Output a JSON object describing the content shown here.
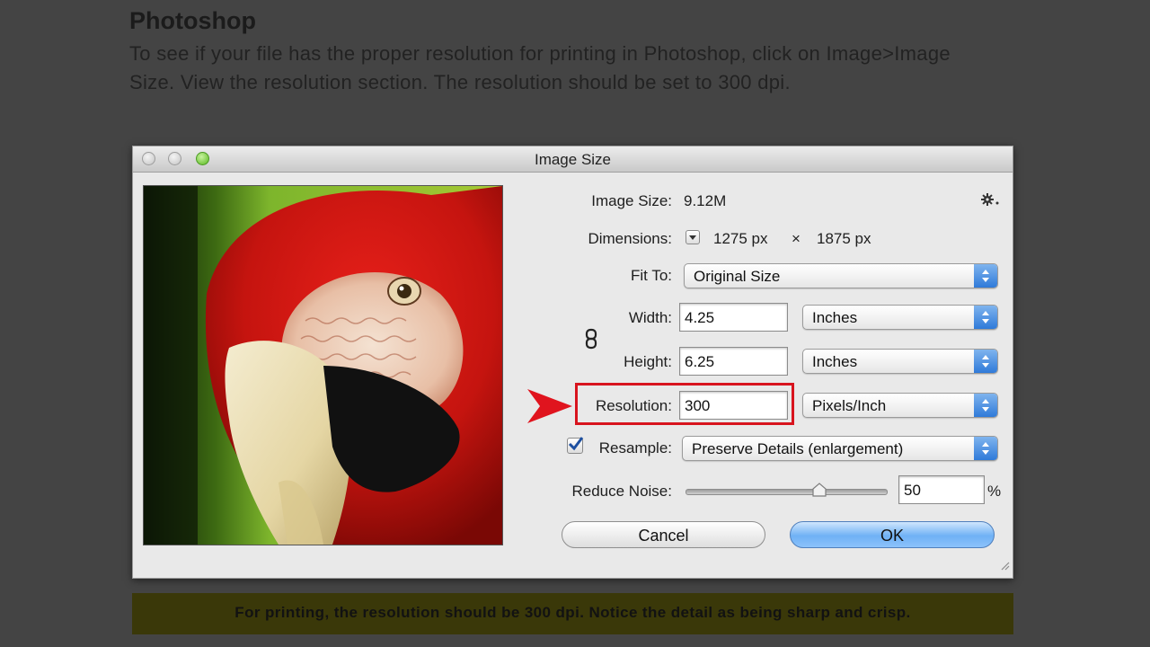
{
  "slide": {
    "title": "Photoshop",
    "description": "To see if your file has the proper resolution for printing in Photoshop, click on Image>Image Size. View the resolution section. The resolution should be set to 300 dpi.",
    "caption": "For printing, the resolution should be 300 dpi. Notice the detail as being sharp and crisp."
  },
  "dialog": {
    "title": "Image Size",
    "image_size_label": "Image Size:",
    "image_size_value": "9.12M",
    "dimensions_label": "Dimensions:",
    "dimensions_width": "1275 px",
    "dimensions_times": "×",
    "dimensions_height": "1875 px",
    "fit_to_label": "Fit To:",
    "fit_to_value": "Original Size",
    "width_label": "Width:",
    "width_value": "4.25",
    "width_unit": "Inches",
    "height_label": "Height:",
    "height_value": "6.25",
    "height_unit": "Inches",
    "resolution_label": "Resolution:",
    "resolution_value": "300",
    "resolution_unit": "Pixels/Inch",
    "resample_label": "Resample:",
    "resample_checked": true,
    "resample_value": "Preserve Details (enlargement)",
    "reduce_noise_label": "Reduce Noise:",
    "reduce_noise_value": "50",
    "reduce_noise_fraction": 0.66,
    "percent_sign": "%",
    "cancel_label": "Cancel",
    "ok_label": "OK"
  },
  "colors": {
    "highlight": "#d8141e",
    "arrow": "#e0141e",
    "ok_button": "#6fb1f5",
    "stepper": "#2f7ad9",
    "caption_bar": "#3a3809"
  },
  "icons": [
    "gear-icon",
    "chain-link-icon",
    "dimensions-dropdown-icon",
    "red-arrow-icon",
    "resize-grip-icon",
    "checkmark-icon"
  ]
}
